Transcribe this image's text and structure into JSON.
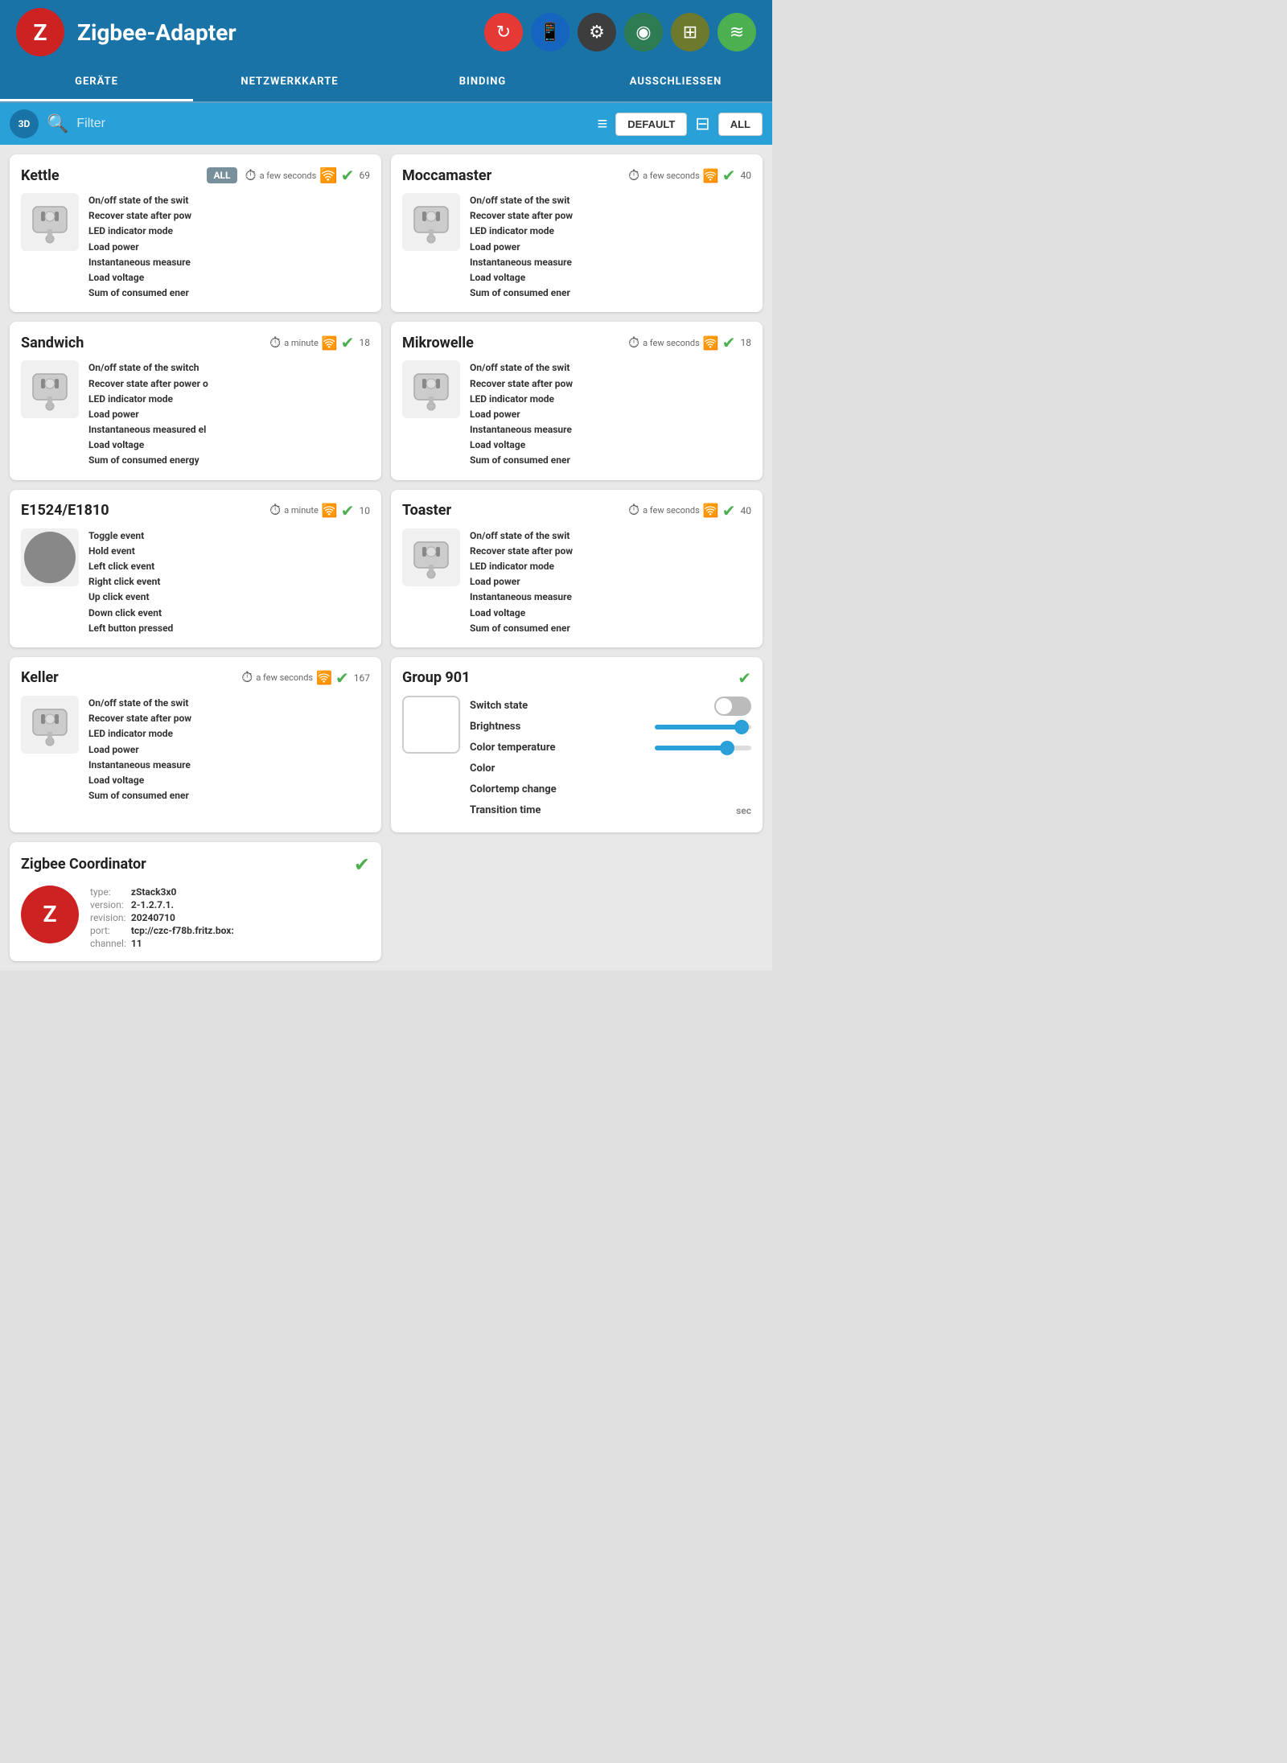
{
  "app": {
    "title": "Zigbee-Adapter",
    "logo": "Z"
  },
  "header": {
    "icons": [
      {
        "name": "refresh-icon",
        "symbol": "↻",
        "class": "icon-red"
      },
      {
        "name": "mobile-icon",
        "symbol": "📱",
        "class": "icon-blue"
      },
      {
        "name": "settings-icon",
        "symbol": "⚙",
        "class": "icon-dark"
      },
      {
        "name": "network-icon",
        "symbol": "◎",
        "class": "icon-teal"
      },
      {
        "name": "grid-icon",
        "symbol": "⊞",
        "class": "icon-olive"
      },
      {
        "name": "signal-icon",
        "symbol": "≋",
        "class": "icon-green2"
      }
    ]
  },
  "nav": {
    "tabs": [
      {
        "label": "GERÄTE",
        "active": true
      },
      {
        "label": "NETZWERKKARTE",
        "active": false
      },
      {
        "label": "BINDING",
        "active": false
      },
      {
        "label": "AUSSCHLIESSEN",
        "active": false
      }
    ]
  },
  "toolbar": {
    "filter_placeholder": "Filter",
    "default_label": "DEFAULT",
    "all_label": "ALL",
    "all_badge": "ALL"
  },
  "devices": [
    {
      "id": "kettle",
      "name": "Kettle",
      "time": "a few seconds",
      "count": "69",
      "show_all_badge": true,
      "type": "plug",
      "attributes": [
        "On/off state of the swit",
        "Recover state after pow",
        "LED indicator mode",
        "Load power",
        "Instantaneous measure",
        "Load voltage",
        "Sum of consumed ener"
      ]
    },
    {
      "id": "moccamaster",
      "name": "Moccamaster",
      "time": "a few seconds",
      "count": "40",
      "show_all_badge": false,
      "type": "plug",
      "attributes": [
        "On/off state of the swit",
        "Recover state after pow",
        "LED indicator mode",
        "Load power",
        "Instantaneous measure",
        "Load voltage",
        "Sum of consumed ener"
      ]
    },
    {
      "id": "sandwich",
      "name": "Sandwich",
      "time": "a minute",
      "count": "18",
      "show_all_badge": false,
      "type": "plug",
      "attributes": [
        "On/off state of the switch",
        "Recover state after power o",
        "LED indicator mode",
        "Load power",
        "Instantaneous measured el",
        "Load voltage",
        "Sum of consumed energy"
      ]
    },
    {
      "id": "mikrowelle",
      "name": "Mikrowelle",
      "time": "a few seconds",
      "count": "18",
      "show_all_badge": false,
      "type": "plug",
      "attributes": [
        "On/off state of the swit",
        "Recover state after pow",
        "LED indicator mode",
        "Load power",
        "Instantaneous measure",
        "Load voltage",
        "Sum of consumed ener"
      ]
    },
    {
      "id": "e1524",
      "name": "E1524/E1810",
      "time": "a minute",
      "count": "10",
      "show_all_badge": false,
      "type": "round",
      "attributes": [
        "Toggle event",
        "Hold event",
        "Left click event",
        "Right click event",
        "Up click event",
        "Down click event",
        "Left button pressed"
      ]
    },
    {
      "id": "toaster",
      "name": "Toaster",
      "time": "a few seconds",
      "count": "40",
      "show_all_badge": false,
      "type": "plug",
      "attributes": [
        "On/off state of the swit",
        "Recover state after pow",
        "LED indicator mode",
        "Load power",
        "Instantaneous measure",
        "Load voltage",
        "Sum of consumed ener"
      ]
    },
    {
      "id": "keller",
      "name": "Keller",
      "time": "a few seconds",
      "count": "167",
      "show_all_badge": false,
      "type": "plug",
      "attributes": [
        "On/off state of the swit",
        "Recover state after pow",
        "LED indicator mode",
        "Load power",
        "Instantaneous measure",
        "Load voltage",
        "Sum of consumed ener"
      ]
    }
  ],
  "group901": {
    "name": "Group 901",
    "attributes": [
      {
        "label": "Switch state",
        "control": "toggle"
      },
      {
        "label": "Brightness",
        "control": "slider",
        "value": 90
      },
      {
        "label": "Color temperature",
        "control": "slider",
        "value": 75
      },
      {
        "label": "Color",
        "control": "none"
      },
      {
        "label": "Colortemp change",
        "control": "none"
      },
      {
        "label": "Transition time",
        "control": "sec"
      }
    ]
  },
  "coordinator": {
    "name": "Zigbee Coordinator",
    "logo": "Z",
    "fields": [
      {
        "label": "type:",
        "value": "zStack3x0"
      },
      {
        "label": "version:",
        "value": "2-1.2.7.1."
      },
      {
        "label": "revision:",
        "value": "20240710"
      },
      {
        "label": "port:",
        "value": "tcp://czc-f78b.fritz.box:"
      },
      {
        "label": "channel:",
        "value": "11"
      }
    ]
  }
}
